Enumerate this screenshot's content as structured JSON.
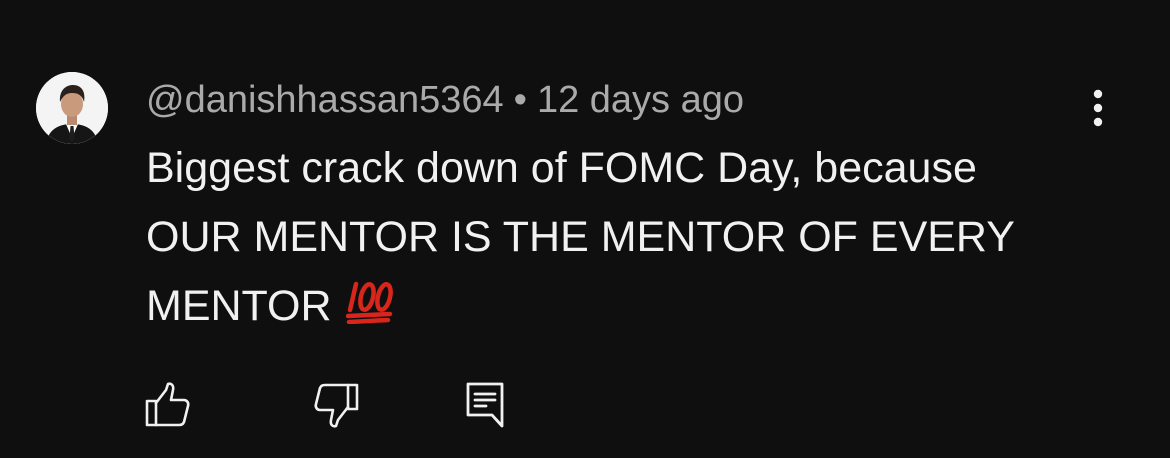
{
  "comment": {
    "author": "@danishhassan5364",
    "separator": "•",
    "time": "12 days ago",
    "text_line1": "Biggest crack down of FOMC Day, because",
    "text_line2": "OUR MENTOR IS THE MENTOR OF EVERY",
    "text_line3": "MENTOR",
    "emoji": "💯"
  },
  "icons": {
    "more": "more-vertical-icon",
    "like": "thumbs-up-icon",
    "dislike": "thumbs-down-icon",
    "reply": "comment-reply-icon"
  },
  "colors": {
    "background": "#0f0f0f",
    "meta_text": "#aaaaaa",
    "body_text": "#f1f1f1",
    "icon": "#f1f1f1",
    "emoji": "#d9261c"
  }
}
